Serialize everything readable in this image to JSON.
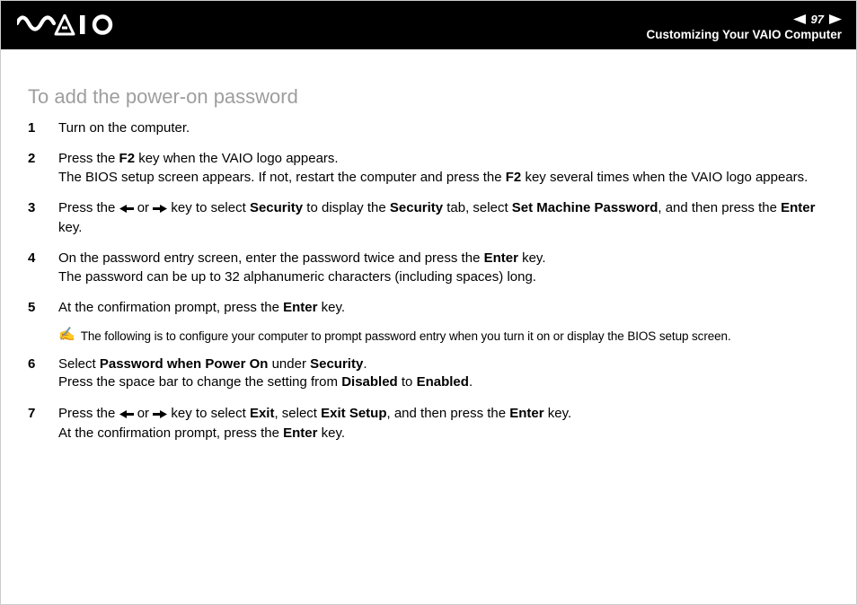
{
  "header": {
    "page_number": "97",
    "section": "Customizing Your VAIO Computer"
  },
  "content": {
    "heading": "To add the power-on password",
    "steps": {
      "s1": "Turn on the computer.",
      "s2a": "Press the ",
      "s2b": "F2",
      "s2c": " key when the VAIO logo appears.",
      "s2d": "The BIOS setup screen appears. If not, restart the computer and press the ",
      "s2e": "F2",
      "s2f": " key several times when the VAIO logo appears.",
      "s3a": "Press the ",
      "s3b": " or ",
      "s3c": " key to select ",
      "s3d": "Security",
      "s3e": " to display the ",
      "s3f": "Security",
      "s3g": " tab, select ",
      "s3h": "Set Machine Password",
      "s3i": ", and then press the ",
      "s3j": "Enter",
      "s3k": " key.",
      "s4a": "On the password entry screen, enter the password twice and press the ",
      "s4b": "Enter",
      "s4c": " key.",
      "s4d": "The password can be up to 32 alphanumeric characters (including spaces) long.",
      "s5a": "At the confirmation prompt, press the ",
      "s5b": "Enter",
      "s5c": " key.",
      "s6a": "Select ",
      "s6b": "Password when Power On",
      "s6c": " under ",
      "s6d": "Security",
      "s6e": ".",
      "s6f": "Press the space bar to change the setting from ",
      "s6g": "Disabled",
      "s6h": " to ",
      "s6i": "Enabled",
      "s6j": ".",
      "s7a": "Press the ",
      "s7b": " or ",
      "s7c": " key to select ",
      "s7d": "Exit",
      "s7e": ", select ",
      "s7f": "Exit Setup",
      "s7g": ", and then press the ",
      "s7h": "Enter",
      "s7i": " key.",
      "s7j": "At the confirmation prompt, press the ",
      "s7k": "Enter",
      "s7l": " key."
    },
    "note": "The following is to configure your computer to prompt password entry when you turn it on or display the BIOS setup screen."
  }
}
